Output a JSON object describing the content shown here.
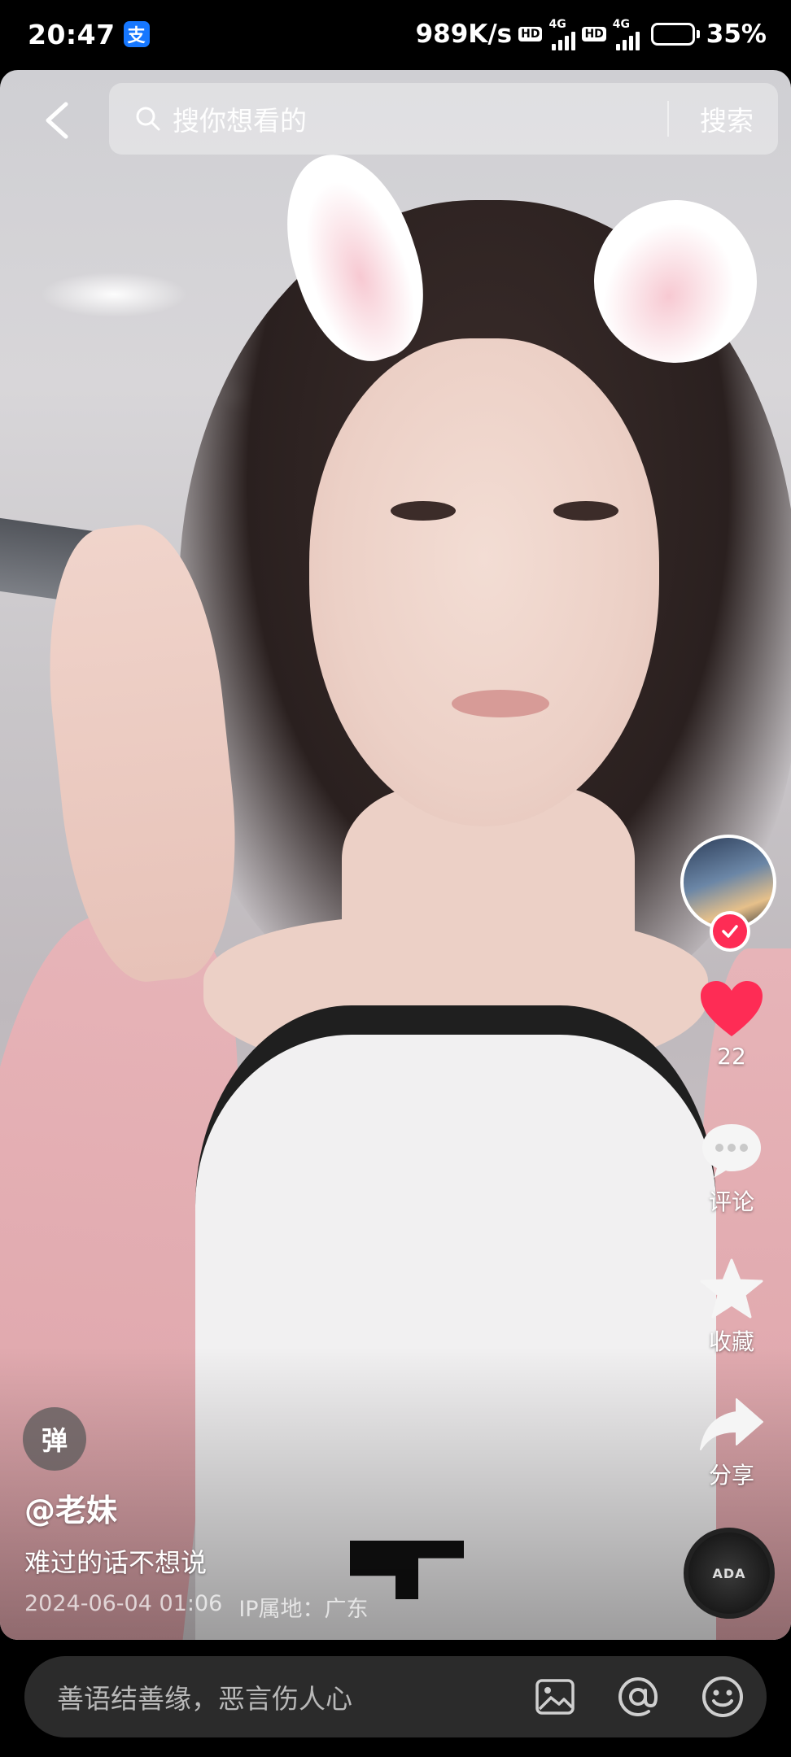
{
  "status_bar": {
    "time": "20:47",
    "alipay_badge": "支",
    "net_speed": "989K/s",
    "hd_label": "HD",
    "net_type": "4G",
    "battery_percent": "35%",
    "battery_level": 0.35
  },
  "search": {
    "placeholder": "搜你想看的",
    "submit_label": "搜索"
  },
  "rail": {
    "like_count": "22",
    "comment_label": "评论",
    "favorite_label": "收藏",
    "share_label": "分享",
    "music_disc_text": "ADA"
  },
  "video_info": {
    "danmu_label": "弹",
    "author": "@老妹",
    "caption": "难过的话不想说",
    "datetime": "2024-06-04 01:06",
    "ip_location": "IP属地：广东"
  },
  "comment_bar": {
    "placeholder": "善语结善缘，恶言伤人心"
  },
  "colors": {
    "like_red": "#fe2c55",
    "background": "#000000",
    "comment_box": "#2b2b2b"
  }
}
